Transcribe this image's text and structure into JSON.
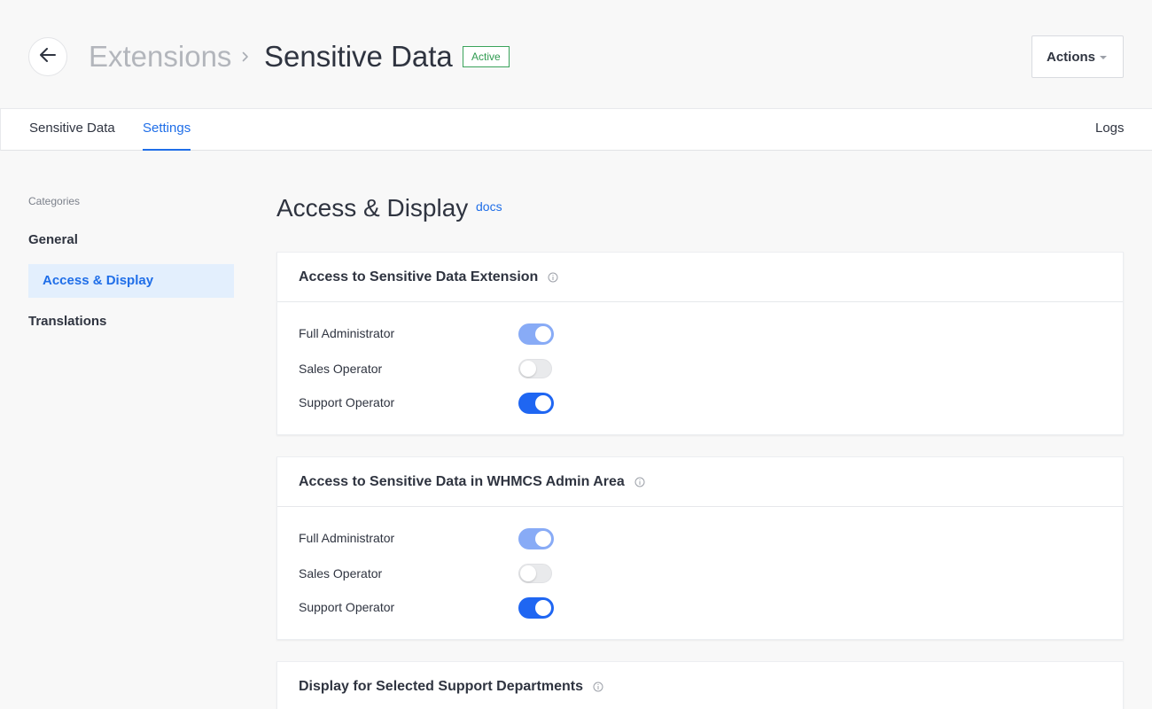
{
  "header": {
    "breadcrumb_parent": "Extensions",
    "breadcrumb_current": "Sensitive Data",
    "status_badge": "Active",
    "actions_label": "Actions"
  },
  "tabs": [
    {
      "label": "Sensitive Data",
      "active": false
    },
    {
      "label": "Settings",
      "active": true
    },
    {
      "label": "Logs",
      "active": false
    }
  ],
  "sidebar": {
    "title": "Categories",
    "items": [
      {
        "label": "General",
        "active": false
      },
      {
        "label": "Access & Display",
        "active": true
      },
      {
        "label": "Translations",
        "active": false
      }
    ]
  },
  "main": {
    "title": "Access & Display",
    "docs_label": "docs",
    "cards": [
      {
        "title": "Access to Sensitive Data Extension",
        "rows": [
          {
            "label": "Full Administrator",
            "state": "on-disabled"
          },
          {
            "label": "Sales Operator",
            "state": "off"
          },
          {
            "label": "Support Operator",
            "state": "on"
          }
        ]
      },
      {
        "title": "Access to Sensitive Data in WHMCS Admin Area",
        "rows": [
          {
            "label": "Full Administrator",
            "state": "on-disabled"
          },
          {
            "label": "Sales Operator",
            "state": "off"
          },
          {
            "label": "Support Operator",
            "state": "on"
          }
        ]
      },
      {
        "title": "Display for Selected Support Departments",
        "rows": []
      }
    ]
  },
  "colors": {
    "accent": "#1f6ee8",
    "toggle_on": "#1f66f2",
    "toggle_on_disabled": "#88abf6",
    "status_green": "#2e9a4f"
  },
  "icons": {
    "back": "arrow-left-icon",
    "separator": "chevron-right-icon",
    "actions_caret": "caret-down-icon",
    "info": "info-icon"
  }
}
